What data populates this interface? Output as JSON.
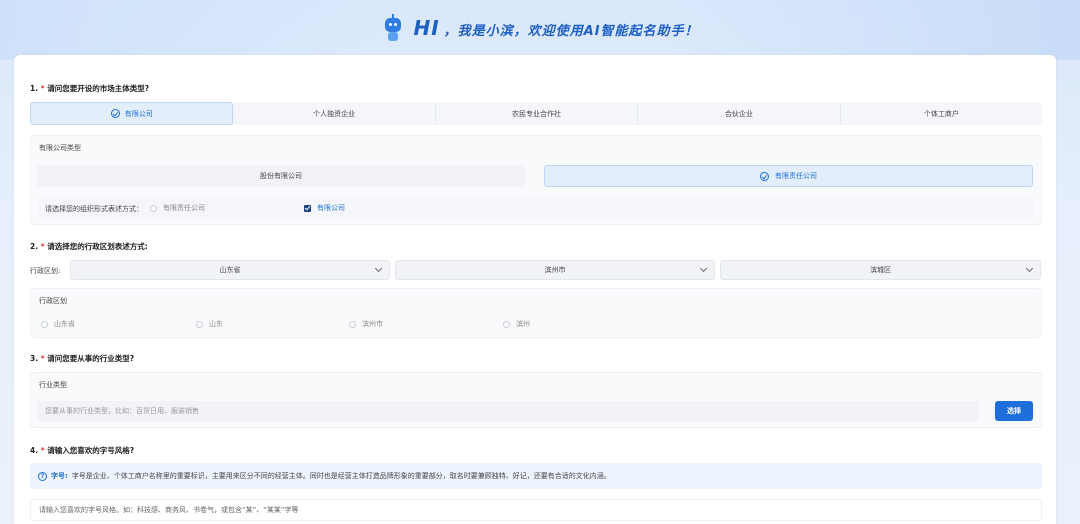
{
  "header": {
    "hi": "HI",
    "greeting": "，我是小滨，欢迎使用AI智能起名助手！"
  },
  "q1": {
    "number": "1.",
    "star": "*",
    "text": "请问您要开设的市场主体类型?",
    "options": [
      "有限公司",
      "个人独资企业",
      "农民专业合作社",
      "合伙企业",
      "个体工商户"
    ],
    "selected_index": 0
  },
  "company_type": {
    "label": "有限公司类型",
    "options": [
      "股份有限公司",
      "有限责任公司"
    ],
    "selected_index": 1,
    "form_prompt": "请选择您的组织形式表述方式：",
    "form_options": [
      "有限责任公司",
      "有限公司"
    ],
    "form_selected_index": 1
  },
  "q2": {
    "number": "2.",
    "star": "*",
    "text": "请选择您的行政区划表述方式:",
    "region_label": "行政区划:",
    "province": "山东省",
    "city": "滨州市",
    "district": "滨城区"
  },
  "region_panel": {
    "label": "行政区划",
    "options": [
      "山东省",
      "山东",
      "滨州市",
      "滨州"
    ]
  },
  "q3": {
    "number": "3.",
    "star": "*",
    "text": "请问您要从事的行业类型?",
    "panel_label": "行业类型",
    "placeholder": "您要从事的行业类型，比如：百货日用、服装销售",
    "button": "选择"
  },
  "q4": {
    "number": "4.",
    "star": "*",
    "text": "请输入您喜欢的字号风格?",
    "info_key": "字号:",
    "info_text": "字号是企业、个体工商户名称里的重要标识，主要用来区分不同的经营主体。同时也是经营主体打造品牌形象的重要部分，取名时要兼顾独特、好记，还要有合适的文化内涵。",
    "placeholder": "请输入您喜欢的字号风格。如：科技感、商务风、书卷气，或包含“某”、“某某”字等"
  },
  "colors": {
    "accent": "#1e6fd9",
    "required": "#e53935"
  }
}
